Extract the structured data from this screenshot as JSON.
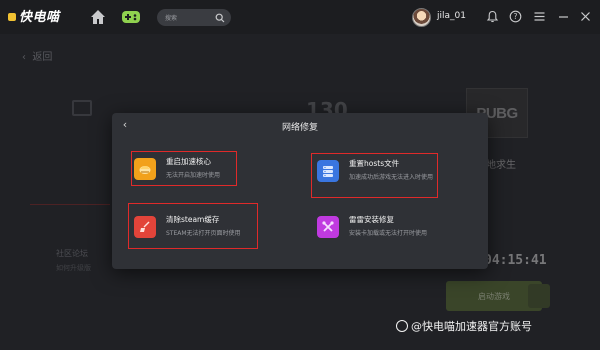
{
  "app": {
    "logo_text": "快电喵",
    "search_placeholder": "搜索",
    "username": "jila_01"
  },
  "background": {
    "back_label": "返回",
    "stat_number": "130",
    "game_title": "地求生",
    "game_logo": "PUBG",
    "timer": "04:15:41",
    "launch_label": "启动游戏",
    "community_title": "社区论坛",
    "community_sub": "如何升级版"
  },
  "modal": {
    "title": "网络修复",
    "options": [
      {
        "title": "重启加速核心",
        "desc": "无法开启加速时使用",
        "icon": "restart-core-icon",
        "color": "#f2a11b"
      },
      {
        "title": "重置hosts文件",
        "desc": "加速成功后游戏无法进入时使用",
        "icon": "hosts-file-icon",
        "color": "#3a76e0"
      },
      {
        "title": "清除steam缓存",
        "desc": "STEAM无法打开页面时使用",
        "icon": "broom-icon",
        "color": "#e2443a"
      },
      {
        "title": "雷雷安装修复",
        "desc": "安装卡加载或无法打开时使用",
        "icon": "repair-tools-icon",
        "color": "#c03ae0"
      }
    ]
  },
  "watermark": "@快电喵加速器官方账号",
  "colors": {
    "highlight": "#e02a2a",
    "modal_bg": "#2f3136",
    "titlebar": "#1c1d20"
  }
}
